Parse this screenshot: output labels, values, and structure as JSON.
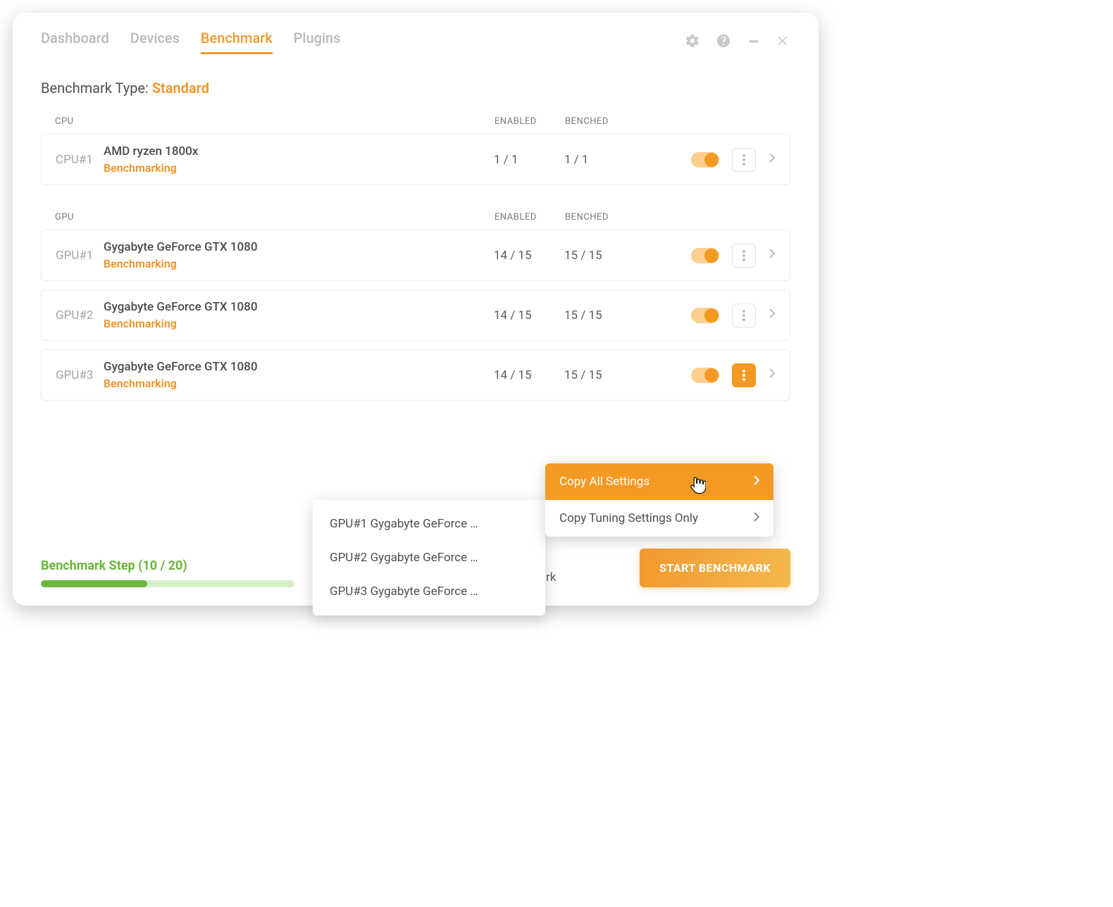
{
  "tabs": {
    "dashboard": "Dashboard",
    "devices": "Devices",
    "benchmark": "Benchmark",
    "plugins": "Plugins"
  },
  "type_label": "Benchmark Type:",
  "type_value": "Standard",
  "columns": {
    "enabled": "ENABLED",
    "benched": "BENCHED"
  },
  "sections": {
    "cpu_label": "CPU",
    "gpu_label": "GPU"
  },
  "cpus": [
    {
      "id": "CPU#1",
      "name": "AMD ryzen 1800x",
      "status": "Benchmarking",
      "enabled": "1 / 1",
      "benched": "1 / 1"
    }
  ],
  "gpus": [
    {
      "id": "GPU#1",
      "name": "Gygabyte GeForce GTX 1080",
      "status": "Benchmarking",
      "enabled": "14 / 15",
      "benched": "15 / 15"
    },
    {
      "id": "GPU#2",
      "name": "Gygabyte GeForce GTX 1080",
      "status": "Benchmarking",
      "enabled": "14 / 15",
      "benched": "15 / 15"
    },
    {
      "id": "GPU#3",
      "name": "Gygabyte GeForce GTX 1080",
      "status": "Benchmarking",
      "enabled": "14 / 15",
      "benched": "15 / 15"
    }
  ],
  "menu": {
    "copy_all": "Copy All Settings",
    "copy_tuning": "Copy Tuning Settings Only"
  },
  "submenu": [
    "GPU#1 Gygabyte GeForce …",
    "GPU#2 Gygabyte GeForce …",
    "GPU#3 Gygabyte GeForce …"
  ],
  "footer": {
    "step_label": "Benchmark Step (10 / 20)",
    "progress_pct": 42,
    "start_after": "Start mining after benchmark",
    "start_btn": "START BENCHMARK"
  }
}
